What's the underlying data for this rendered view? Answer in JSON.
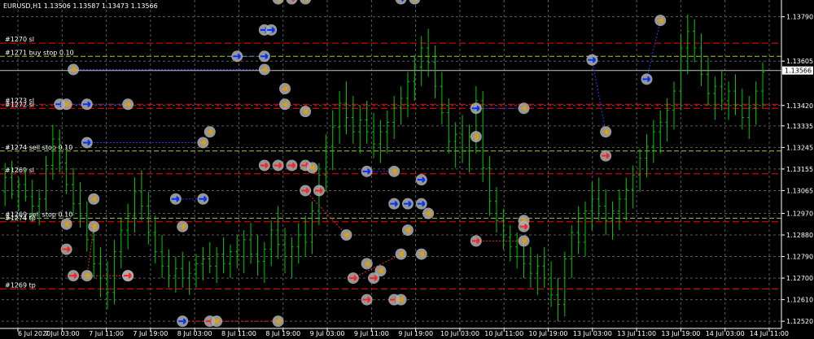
{
  "header": {
    "title": "EURUSD,H1  1.13506 1.13587 1.13473 1.13566"
  },
  "colors": {
    "background": "#000000",
    "grid": "#5a5a5a",
    "axis": "#ffffff",
    "bull_candle": "#00c800",
    "bear_candle": "#00c800",
    "sl_line": "#ff0000",
    "tp_line": "#ff0000",
    "pending_line": "#9acd32",
    "current_price_line": "#bfbfbf",
    "trade_line_buy": "#1e3cff",
    "trade_line_sell": "#ff2020",
    "marker_halo": "#b0b0b0",
    "buy_arrow": "#0030ff",
    "sell_arrow": "#ff2020",
    "close_marker": "#e0a000"
  },
  "chart_data": {
    "type": "candlestick",
    "symbol": "EURUSD",
    "timeframe": "H1",
    "ohlc_header": {
      "open": 1.13506,
      "high": 1.13587,
      "low": 1.13473,
      "close": 1.13566
    },
    "current_price": "1.13566",
    "ylim": [
      1.1249,
      1.1386
    ],
    "yticks": [
      "1.13790",
      "1.13605",
      "1.13420",
      "1.13335",
      "1.13245",
      "1.13155",
      "1.13065",
      "1.12970",
      "1.12880",
      "1.12790",
      "1.12700",
      "1.12610",
      "1.12520"
    ],
    "xticks": [
      "6 Jul 2020",
      "7 Jul 03:00",
      "7 Jul 11:00",
      "7 Jul 19:00",
      "8 Jul 03:00",
      "8 Jul 11:00",
      "8 Jul 19:00",
      "9 Jul 03:00",
      "9 Jul 11:00",
      "9 Jul 19:00",
      "10 Jul 03:00",
      "10 Jul 11:00",
      "10 Jul 19:00",
      "13 Jul 03:00",
      "13 Jul 11:00",
      "13 Jul 19:00",
      "14 Jul 03:00",
      "14 Jul 11:00"
    ],
    "grid": true,
    "order_lines": [
      {
        "label": "#1270 sl",
        "price": 1.1368,
        "kind": "sl"
      },
      {
        "label": "#1271 buy stop 0.10",
        "price": 1.13625,
        "kind": "pending"
      },
      {
        "label": "#1273 sl",
        "price": 1.13425,
        "kind": "sl"
      },
      {
        "label": "#1272 sl",
        "price": 1.13408,
        "kind": "sl"
      },
      {
        "label": "#1274 sell stop 0.10",
        "price": 1.1323,
        "kind": "pending"
      },
      {
        "label": "#1269 sl",
        "price": 1.13135,
        "kind": "sl"
      },
      {
        "label": "#1269 sell stop 0.10",
        "price": 1.1295,
        "kind": "pending"
      },
      {
        "label": "#1274 tp",
        "price": 1.12935,
        "kind": "tp"
      },
      {
        "label": "#1269 tp",
        "price": 1.12655,
        "kind": "tp"
      }
    ],
    "candles": [
      [
        1.1306,
        1.1318,
        1.13,
        1.1312
      ],
      [
        1.1312,
        1.1319,
        1.1303,
        1.1305
      ],
      [
        1.1305,
        1.1312,
        1.1298,
        1.1309
      ],
      [
        1.1309,
        1.1316,
        1.1302,
        1.1304
      ],
      [
        1.1304,
        1.1311,
        1.1295,
        1.13
      ],
      [
        1.13,
        1.1307,
        1.1292,
        1.1303
      ],
      [
        1.1303,
        1.1321,
        1.1298,
        1.1317
      ],
      [
        1.1317,
        1.1334,
        1.1311,
        1.1328
      ],
      [
        1.1328,
        1.1332,
        1.1314,
        1.1318
      ],
      [
        1.1318,
        1.1324,
        1.1305,
        1.1309
      ],
      [
        1.1309,
        1.1316,
        1.1296,
        1.1301
      ],
      [
        1.1301,
        1.131,
        1.1291,
        1.1296
      ],
      [
        1.1296,
        1.1302,
        1.1281,
        1.1286
      ],
      [
        1.1286,
        1.1292,
        1.127,
        1.1276
      ],
      [
        1.1276,
        1.1283,
        1.1262,
        1.127
      ],
      [
        1.127,
        1.1277,
        1.1257,
        1.1264
      ],
      [
        1.1264,
        1.1286,
        1.1259,
        1.1281
      ],
      [
        1.1281,
        1.1295,
        1.1274,
        1.129
      ],
      [
        1.129,
        1.1301,
        1.1282,
        1.1296
      ],
      [
        1.1296,
        1.1312,
        1.1289,
        1.1306
      ],
      [
        1.1306,
        1.1315,
        1.1294,
        1.13
      ],
      [
        1.13,
        1.1306,
        1.1284,
        1.1289
      ],
      [
        1.1289,
        1.1296,
        1.1276,
        1.1281
      ],
      [
        1.1281,
        1.1288,
        1.127,
        1.1275
      ],
      [
        1.1275,
        1.1282,
        1.1266,
        1.1271
      ],
      [
        1.1271,
        1.1279,
        1.1264,
        1.1274
      ],
      [
        1.1274,
        1.1281,
        1.1266,
        1.127
      ],
      [
        1.127,
        1.1277,
        1.1263,
        1.1272
      ],
      [
        1.1272,
        1.128,
        1.1266,
        1.1276
      ],
      [
        1.1276,
        1.1283,
        1.1269,
        1.1278
      ],
      [
        1.1278,
        1.1285,
        1.1272,
        1.1275
      ],
      [
        1.1275,
        1.1283,
        1.1268,
        1.128
      ],
      [
        1.128,
        1.1287,
        1.1272,
        1.1276
      ],
      [
        1.1276,
        1.1284,
        1.127,
        1.1281
      ],
      [
        1.1281,
        1.1288,
        1.1274,
        1.1279
      ],
      [
        1.1279,
        1.129,
        1.1272,
        1.1286
      ],
      [
        1.1286,
        1.1293,
        1.1276,
        1.128
      ],
      [
        1.128,
        1.1288,
        1.1271,
        1.1277
      ],
      [
        1.1277,
        1.1285,
        1.1268,
        1.1282
      ],
      [
        1.1282,
        1.1294,
        1.1275,
        1.129
      ],
      [
        1.129,
        1.13,
        1.1278,
        1.1284
      ],
      [
        1.1284,
        1.1291,
        1.1272,
        1.1279
      ],
      [
        1.1279,
        1.1287,
        1.127,
        1.1283
      ],
      [
        1.1283,
        1.1293,
        1.1276,
        1.1288
      ],
      [
        1.1288,
        1.1296,
        1.1279,
        1.1285
      ],
      [
        1.1285,
        1.1302,
        1.128,
        1.1298
      ],
      [
        1.1298,
        1.1318,
        1.1292,
        1.1313
      ],
      [
        1.1313,
        1.133,
        1.1306,
        1.1325
      ],
      [
        1.1325,
        1.134,
        1.1315,
        1.1333
      ],
      [
        1.1333,
        1.1348,
        1.1326,
        1.1343
      ],
      [
        1.1343,
        1.1352,
        1.133,
        1.1337
      ],
      [
        1.1337,
        1.1346,
        1.1326,
        1.1331
      ],
      [
        1.1331,
        1.1342,
        1.1322,
        1.1336
      ],
      [
        1.1336,
        1.1344,
        1.1326,
        1.1331
      ],
      [
        1.1331,
        1.1339,
        1.132,
        1.1326
      ],
      [
        1.1326,
        1.1336,
        1.1318,
        1.1331
      ],
      [
        1.1331,
        1.134,
        1.1322,
        1.1335
      ],
      [
        1.1335,
        1.1346,
        1.1328,
        1.1341
      ],
      [
        1.1341,
        1.135,
        1.1334,
        1.1345
      ],
      [
        1.1345,
        1.1356,
        1.1337,
        1.1352
      ],
      [
        1.1352,
        1.1363,
        1.1344,
        1.1358
      ],
      [
        1.1358,
        1.1371,
        1.135,
        1.1366
      ],
      [
        1.1366,
        1.1374,
        1.1354,
        1.136
      ],
      [
        1.136,
        1.1367,
        1.1345,
        1.135
      ],
      [
        1.135,
        1.1356,
        1.1334,
        1.1339
      ],
      [
        1.1339,
        1.1345,
        1.1322,
        1.1327
      ],
      [
        1.1327,
        1.1335,
        1.1316,
        1.133
      ],
      [
        1.133,
        1.1338,
        1.1318,
        1.1323
      ],
      [
        1.1323,
        1.1334,
        1.1314,
        1.1329
      ],
      [
        1.1329,
        1.135,
        1.1322,
        1.1344
      ],
      [
        1.1344,
        1.1348,
        1.131,
        1.1316
      ],
      [
        1.1316,
        1.1321,
        1.1296,
        1.1302
      ],
      [
        1.1302,
        1.1308,
        1.1289,
        1.1294
      ],
      [
        1.1294,
        1.1299,
        1.1282,
        1.1287
      ],
      [
        1.1287,
        1.1292,
        1.1277,
        1.1283
      ],
      [
        1.1283,
        1.1289,
        1.1274,
        1.1279
      ],
      [
        1.1279,
        1.1286,
        1.127,
        1.1276
      ],
      [
        1.1276,
        1.1283,
        1.1266,
        1.1272
      ],
      [
        1.1272,
        1.128,
        1.1263,
        1.1275
      ],
      [
        1.1275,
        1.1283,
        1.1266,
        1.127
      ],
      [
        1.127,
        1.1277,
        1.1258,
        1.1263
      ],
      [
        1.1263,
        1.127,
        1.1252,
        1.1259
      ],
      [
        1.1259,
        1.1281,
        1.1254,
        1.1278
      ],
      [
        1.1278,
        1.1292,
        1.127,
        1.1289
      ],
      [
        1.1289,
        1.13,
        1.128,
        1.1285
      ],
      [
        1.1285,
        1.1302,
        1.1279,
        1.1298
      ],
      [
        1.1298,
        1.131,
        1.129,
        1.1303
      ],
      [
        1.1303,
        1.1312,
        1.1294,
        1.13
      ],
      [
        1.13,
        1.1307,
        1.1288,
        1.1294
      ],
      [
        1.1294,
        1.1302,
        1.1286,
        1.1298
      ],
      [
        1.1298,
        1.1307,
        1.129,
        1.1303
      ],
      [
        1.1303,
        1.1312,
        1.1294,
        1.1307
      ],
      [
        1.1307,
        1.1317,
        1.1299,
        1.1313
      ],
      [
        1.1313,
        1.1324,
        1.1306,
        1.132
      ],
      [
        1.132,
        1.133,
        1.1312,
        1.1325
      ],
      [
        1.1325,
        1.1336,
        1.1318,
        1.1331
      ],
      [
        1.1331,
        1.134,
        1.1322,
        1.1335
      ],
      [
        1.1335,
        1.1345,
        1.1327,
        1.134
      ],
      [
        1.134,
        1.1352,
        1.1332,
        1.1348
      ],
      [
        1.1348,
        1.1372,
        1.134,
        1.1366
      ],
      [
        1.1366,
        1.138,
        1.1355,
        1.1373
      ],
      [
        1.1373,
        1.1378,
        1.136,
        1.1366
      ],
      [
        1.1366,
        1.1372,
        1.135,
        1.1355
      ],
      [
        1.1355,
        1.1362,
        1.1342,
        1.1347
      ],
      [
        1.1347,
        1.1354,
        1.1336,
        1.135
      ],
      [
        1.135,
        1.1357,
        1.134,
        1.1344
      ],
      [
        1.1344,
        1.1352,
        1.1336,
        1.1348
      ],
      [
        1.1348,
        1.1355,
        1.1338,
        1.1342
      ],
      [
        1.1342,
        1.1349,
        1.1332,
        1.1337
      ],
      [
        1.1337,
        1.1346,
        1.1328,
        1.1341
      ],
      [
        1.1341,
        1.1352,
        1.1334,
        1.1348
      ],
      [
        1.1348,
        1.136,
        1.1341,
        1.1356
      ]
    ],
    "trade_markers": [
      {
        "kind": "close",
        "price": 1.13865,
        "bar": 40
      },
      {
        "kind": "sell",
        "price": 1.13865,
        "bar": 42
      },
      {
        "kind": "close",
        "price": 1.13865,
        "bar": 44
      },
      {
        "kind": "buy",
        "price": 1.13865,
        "bar": 58
      },
      {
        "kind": "close",
        "price": 1.13865,
        "bar": 60
      },
      {
        "kind": "buy",
        "price": 1.13735,
        "bar": 38
      },
      {
        "kind": "buy",
        "price": 1.13735,
        "bar": 39
      },
      {
        "kind": "close",
        "price": 1.13775,
        "bar": 96
      },
      {
        "kind": "buy",
        "price": 1.13625,
        "bar": 34
      },
      {
        "kind": "buy",
        "price": 1.13625,
        "bar": 38
      },
      {
        "kind": "buy",
        "price": 1.1361,
        "bar": 86
      },
      {
        "kind": "close",
        "price": 1.1357,
        "bar": 10
      },
      {
        "kind": "close",
        "price": 1.1357,
        "bar": 38
      },
      {
        "kind": "buy",
        "price": 1.1353,
        "bar": 94
      },
      {
        "kind": "close",
        "price": 1.1349,
        "bar": 41
      },
      {
        "kind": "buy",
        "price": 1.13425,
        "bar": 8
      },
      {
        "kind": "close",
        "price": 1.13425,
        "bar": 9
      },
      {
        "kind": "buy",
        "price": 1.13425,
        "bar": 12
      },
      {
        "kind": "close",
        "price": 1.13425,
        "bar": 18
      },
      {
        "kind": "close",
        "price": 1.13425,
        "bar": 41
      },
      {
        "kind": "buy",
        "price": 1.13408,
        "bar": 69
      },
      {
        "kind": "close",
        "price": 1.13408,
        "bar": 76
      },
      {
        "kind": "close",
        "price": 1.13395,
        "bar": 44
      },
      {
        "kind": "close",
        "price": 1.1331,
        "bar": 30
      },
      {
        "kind": "close",
        "price": 1.1331,
        "bar": 88
      },
      {
        "kind": "close",
        "price": 1.1329,
        "bar": 69
      },
      {
        "kind": "buy",
        "price": 1.13265,
        "bar": 12
      },
      {
        "kind": "close",
        "price": 1.13265,
        "bar": 29
      },
      {
        "kind": "sell",
        "price": 1.1321,
        "bar": 88
      },
      {
        "kind": "sell",
        "price": 1.1317,
        "bar": 38
      },
      {
        "kind": "sell",
        "price": 1.1317,
        "bar": 40
      },
      {
        "kind": "sell",
        "price": 1.1317,
        "bar": 42
      },
      {
        "kind": "sell",
        "price": 1.1317,
        "bar": 44
      },
      {
        "kind": "close",
        "price": 1.1316,
        "bar": 45
      },
      {
        "kind": "buy",
        "price": 1.13145,
        "bar": 53
      },
      {
        "kind": "close",
        "price": 1.13145,
        "bar": 57
      },
      {
        "kind": "buy",
        "price": 1.1311,
        "bar": 61
      },
      {
        "kind": "sell",
        "price": 1.13065,
        "bar": 44
      },
      {
        "kind": "sell",
        "price": 1.13065,
        "bar": 46
      },
      {
        "kind": "close",
        "price": 1.1303,
        "bar": 13
      },
      {
        "kind": "buy",
        "price": 1.1303,
        "bar": 25
      },
      {
        "kind": "buy",
        "price": 1.1303,
        "bar": 29
      },
      {
        "kind": "buy",
        "price": 1.1301,
        "bar": 57
      },
      {
        "kind": "buy",
        "price": 1.1301,
        "bar": 59
      },
      {
        "kind": "buy",
        "price": 1.1301,
        "bar": 61
      },
      {
        "kind": "close",
        "price": 1.1297,
        "bar": 62
      },
      {
        "kind": "close",
        "price": 1.1294,
        "bar": 76
      },
      {
        "kind": "close",
        "price": 1.12925,
        "bar": 9
      },
      {
        "kind": "close",
        "price": 1.12915,
        "bar": 13
      },
      {
        "kind": "close",
        "price": 1.12915,
        "bar": 26
      },
      {
        "kind": "sell",
        "price": 1.12915,
        "bar": 76
      },
      {
        "kind": "close",
        "price": 1.129,
        "bar": 59
      },
      {
        "kind": "close",
        "price": 1.1288,
        "bar": 50
      },
      {
        "kind": "sell",
        "price": 1.12855,
        "bar": 69
      },
      {
        "kind": "close",
        "price": 1.12855,
        "bar": 76
      },
      {
        "kind": "sell",
        "price": 1.1282,
        "bar": 9
      },
      {
        "kind": "close",
        "price": 1.128,
        "bar": 58
      },
      {
        "kind": "close",
        "price": 1.128,
        "bar": 61
      },
      {
        "kind": "close",
        "price": 1.1276,
        "bar": 53
      },
      {
        "kind": "sell",
        "price": 1.1271,
        "bar": 10
      },
      {
        "kind": "close",
        "price": 1.1271,
        "bar": 12
      },
      {
        "kind": "close",
        "price": 1.1271,
        "bar": 18
      },
      {
        "kind": "sell",
        "price": 1.1271,
        "bar": 18
      },
      {
        "kind": "sell",
        "price": 1.127,
        "bar": 51
      },
      {
        "kind": "sell",
        "price": 1.127,
        "bar": 54
      },
      {
        "kind": "close",
        "price": 1.1273,
        "bar": 55
      },
      {
        "kind": "sell",
        "price": 1.1261,
        "bar": 53
      },
      {
        "kind": "sell",
        "price": 1.1261,
        "bar": 57
      },
      {
        "kind": "close",
        "price": 1.1261,
        "bar": 58
      },
      {
        "kind": "buy",
        "price": 1.1252,
        "bar": 26
      },
      {
        "kind": "sell",
        "price": 1.1252,
        "bar": 30
      },
      {
        "kind": "close",
        "price": 1.1252,
        "bar": 31
      },
      {
        "kind": "close",
        "price": 1.1252,
        "bar": 40
      }
    ],
    "trade_links": [
      {
        "from_bar": 10,
        "from_price": 1.1357,
        "to_bar": 38,
        "to_price": 1.1357,
        "side": "buy"
      },
      {
        "from_bar": 8,
        "from_price": 1.13425,
        "to_bar": 18,
        "to_price": 1.13425,
        "side": "buy"
      },
      {
        "from_bar": 12,
        "from_price": 1.13265,
        "to_bar": 29,
        "to_price": 1.13265,
        "side": "buy"
      },
      {
        "from_bar": 25,
        "from_price": 1.1303,
        "to_bar": 29,
        "to_price": 1.1303,
        "side": "buy"
      },
      {
        "from_bar": 34,
        "from_price": 1.13625,
        "to_bar": 38,
        "to_price": 1.13625,
        "side": "buy"
      },
      {
        "from_bar": 69,
        "from_price": 1.13408,
        "to_bar": 76,
        "to_price": 1.13408,
        "side": "buy"
      },
      {
        "from_bar": 53,
        "from_price": 1.13145,
        "to_bar": 57,
        "to_price": 1.13145,
        "side": "buy"
      },
      {
        "from_bar": 10,
        "from_price": 1.1271,
        "to_bar": 18,
        "to_price": 1.1271,
        "side": "sell"
      },
      {
        "from_bar": 69,
        "from_price": 1.12855,
        "to_bar": 76,
        "to_price": 1.12855,
        "side": "sell"
      },
      {
        "from_bar": 26,
        "from_price": 1.1252,
        "to_bar": 40,
        "to_price": 1.1252,
        "side": "sell"
      },
      {
        "from_bar": 44,
        "from_price": 1.13065,
        "to_bar": 50,
        "to_price": 1.1288,
        "side": "sell"
      },
      {
        "from_bar": 51,
        "from_price": 1.127,
        "to_bar": 58,
        "to_price": 1.128,
        "side": "sell"
      },
      {
        "from_bar": 12,
        "from_price": 1.1271,
        "to_bar": 13,
        "to_price": 1.12915,
        "side": "sell"
      },
      {
        "from_bar": 86,
        "from_price": 1.1361,
        "to_bar": 88,
        "to_price": 1.1331,
        "side": "buy"
      },
      {
        "from_bar": 94,
        "from_price": 1.1353,
        "to_bar": 96,
        "to_price": 1.13775,
        "side": "buy"
      }
    ]
  }
}
